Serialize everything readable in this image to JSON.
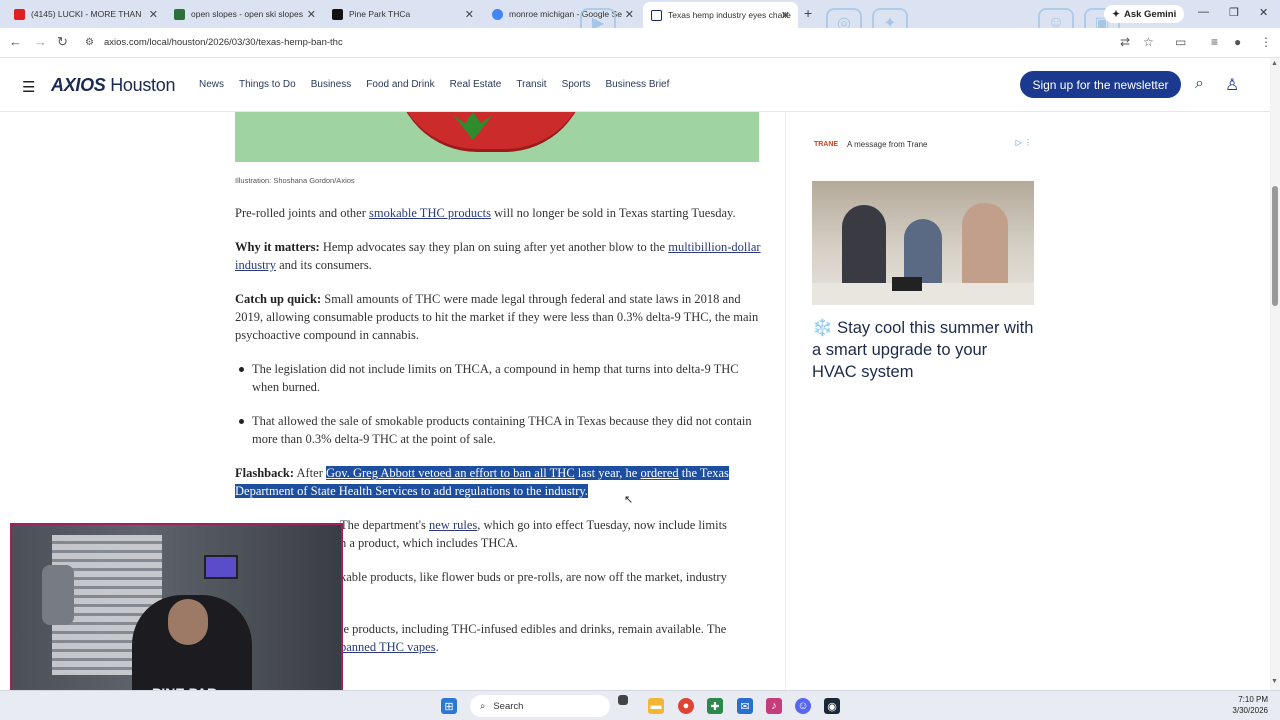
{
  "browser": {
    "tabs": [
      {
        "title": "(4145) LUCKI - MORE THAN",
        "favicon_color": "#e02020",
        "active": false
      },
      {
        "title": "open slopes - open ski slopes",
        "favicon_color": "#2c6f3a",
        "active": false
      },
      {
        "title": "Pine Park THCa",
        "favicon_color": "#111111",
        "active": false
      },
      {
        "title": "monroe michigan - Google Se",
        "favicon_color": "#4285f4",
        "active": false
      },
      {
        "title": "Texas hemp industry eyes challe",
        "favicon_color": "#1a2a55",
        "active": true
      }
    ],
    "gemini_label": "Ask Gemini",
    "url": "axios.com/local/houston/2026/03/30/texas-hemp-ban-thc"
  },
  "site": {
    "logo_brand": "AXIOS",
    "logo_city": "Houston",
    "nav": [
      "News",
      "Things to Do",
      "Business",
      "Food and Drink",
      "Real Estate",
      "Transit",
      "Sports",
      "Business Brief"
    ],
    "signup_label": "Sign up for the newsletter"
  },
  "article": {
    "caption": "Illustration: Shoshana Gordon/Axios",
    "p1_before": "Pre-rolled joints and other ",
    "p1_link": "smokable THC products",
    "p1_after": " will no longer be sold in Texas starting Tuesday.",
    "p2_label": "Why it matters:",
    "p2_text": " Hemp advocates say they plan on suing after yet another blow to the ",
    "p2_link": "multibillion-dollar industry",
    "p2_after": " and its consumers.",
    "p3_label": "Catch up quick:",
    "p3_text": " Small amounts of THC were made legal through federal and state laws in 2018 and 2019, allowing consumable products to hit the market if they were less than 0.3% delta-9 THC, the main psychoactive compound in cannabis.",
    "bullets": [
      "The legislation did not include limits on THCA, a compound in hemp that turns into delta-9 THC when burned.",
      "That allowed the sale of smokable products containing THCA in Texas because they did not contain more than 0.3% delta-9 THC at the point of sale."
    ],
    "p4_label": "Flashback:",
    "p4_pre": " After ",
    "p4_link1": "Gov. Greg Abbott vetoed an effort to ban all THC",
    "p4_mid": " last year, he ",
    "p4_link2": "ordered",
    "p4_after": " the Texas Department of State Health Services to add regulations to the industry.",
    "p5_pre": "The department's ",
    "p5_link": "new rules",
    "p5_after": ", which go into effect Tuesday, now include limits",
    "p5_line2": "n a product, which includes THCA.",
    "p6_line1": "kable products, like flower buds or pre-rolls, are now off the market, industry",
    "p7_line1": "le products, including THC-infused edibles and drinks, remain available. The",
    "p7_link": "banned THC vapes",
    "p7_after": "."
  },
  "ad": {
    "sponsor_text": "A message from Trane",
    "sponsor_logo": "TRANE",
    "snow_icon": "❄️",
    "headline": "Stay cool this summer with a smart upgrade to your HVAC system"
  },
  "webcam": {
    "shirt_text": "PINE PAR"
  },
  "taskbar": {
    "search_label": "Search",
    "time": "7:10 PM",
    "date": "3/30/2026"
  }
}
